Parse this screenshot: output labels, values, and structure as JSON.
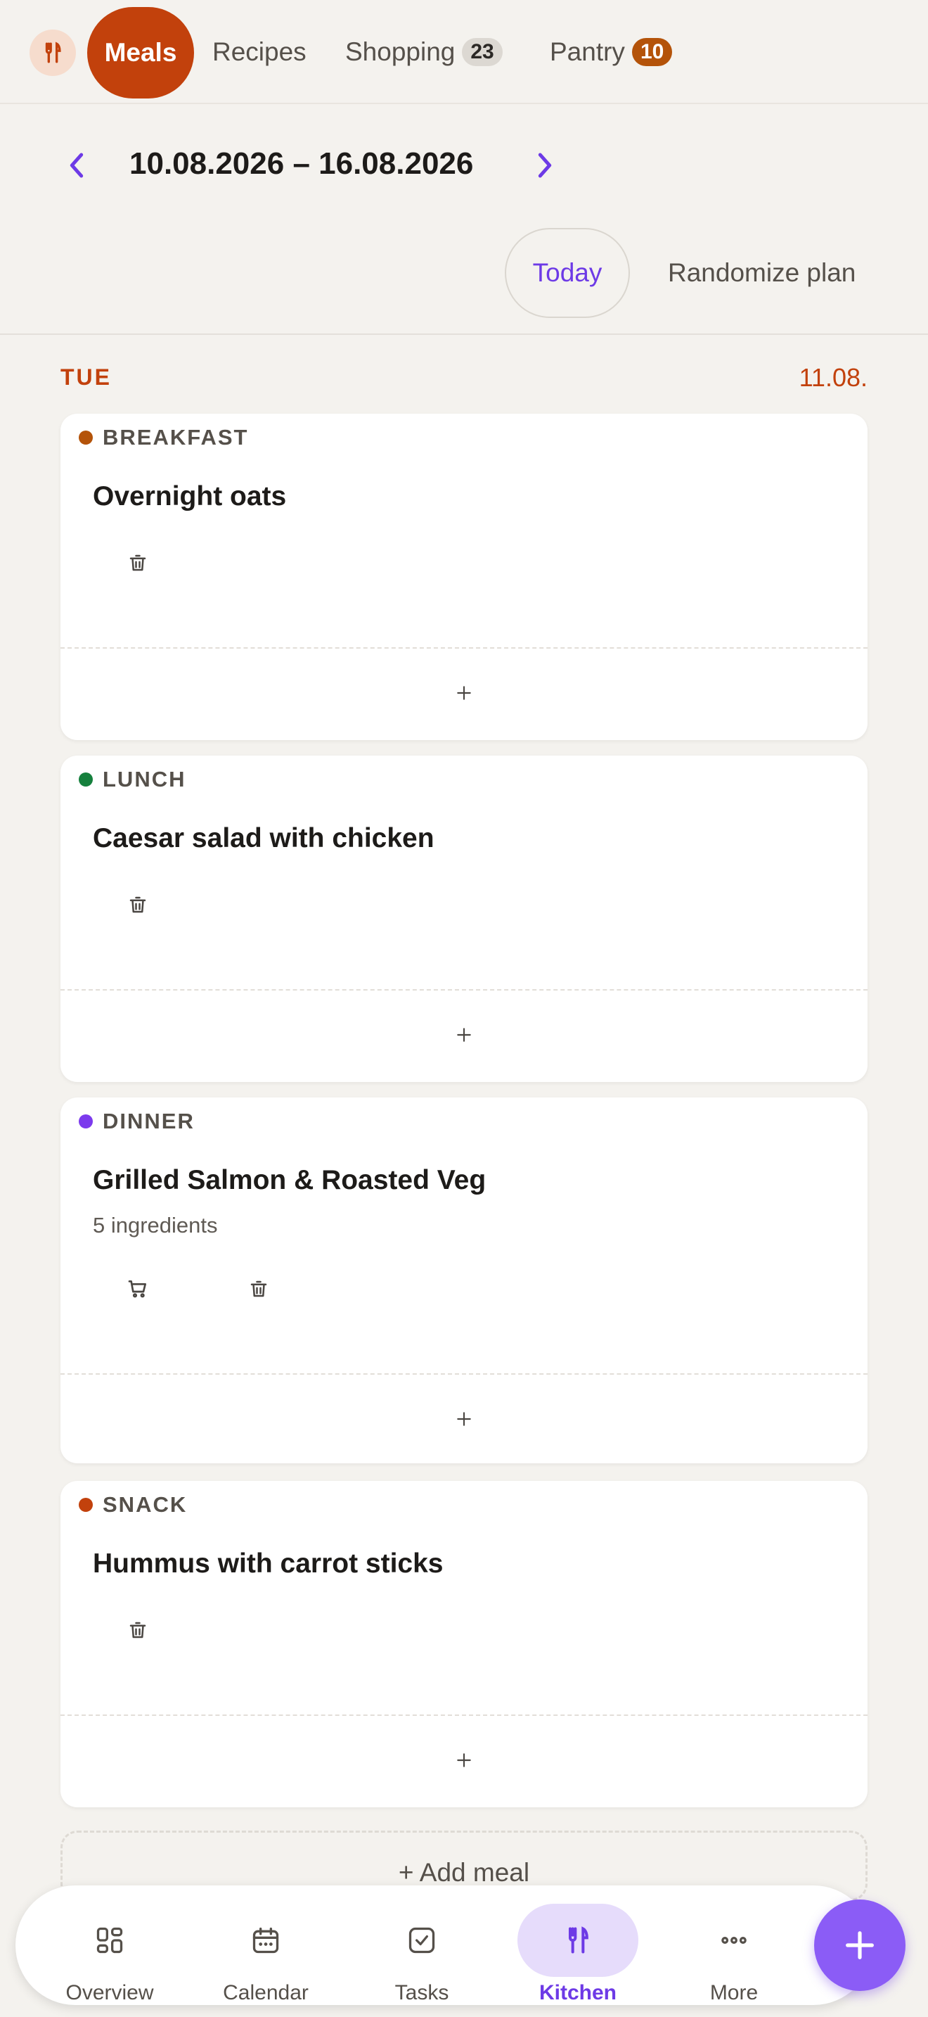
{
  "tabs": {
    "meals": "Meals",
    "recipes": "Recipes",
    "shopping": "Shopping",
    "shopping_count": "23",
    "pantry": "Pantry",
    "pantry_count": "10"
  },
  "week": {
    "range": "10.08.2026 – 16.08.2026",
    "today_label": "Today",
    "randomize_label": "Randomize plan"
  },
  "day": {
    "name": "TUE",
    "date": "11.08."
  },
  "meals": [
    {
      "type": "BREAKFAST",
      "color": "#b45309",
      "name": "Overnight oats",
      "sub": ""
    },
    {
      "type": "LUNCH",
      "color": "#15803d",
      "name": "Caesar salad with chicken",
      "sub": ""
    },
    {
      "type": "DINNER",
      "color": "#7c3aed",
      "name": "Grilled Salmon & Roasted Veg",
      "sub": "5 ingredients"
    },
    {
      "type": "SNACK",
      "color": "#c2410c",
      "name": "Hummus with carrot sticks",
      "sub": ""
    }
  ],
  "add_meal_label": "+ Add meal",
  "bottom_nav": {
    "overview": "Overview",
    "calendar": "Calendar",
    "tasks": "Tasks",
    "kitchen": "Kitchen",
    "more": "More"
  },
  "colors": {
    "accent": "#c2410c",
    "primary": "#6d3ae6"
  }
}
